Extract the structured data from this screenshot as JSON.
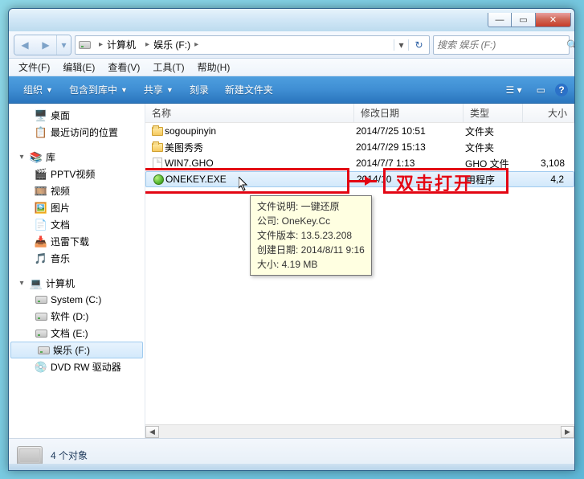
{
  "titlebar": {
    "min": "—",
    "max": "▭",
    "close": "✕"
  },
  "nav": {
    "back": "◀",
    "fwd": "▶",
    "dd": "▾",
    "path": {
      "seg1": "计算机",
      "seg2": "娱乐 (F:)"
    },
    "refresh": "↻"
  },
  "search": {
    "placeholder": "搜索 娱乐 (F:)",
    "icon": "🔍"
  },
  "menu": {
    "file": "文件(F)",
    "edit": "编辑(E)",
    "view": "查看(V)",
    "tools": "工具(T)",
    "help": "帮助(H)"
  },
  "toolbar": {
    "organize": "组织",
    "include": "包含到库中",
    "share": "共享",
    "burn": "刻录",
    "newfolder": "新建文件夹"
  },
  "columns": {
    "name": "名称",
    "date": "修改日期",
    "type": "类型",
    "size": "大小"
  },
  "navpane": {
    "desktop": "桌面",
    "recent": "最近访问的位置",
    "libraries": "库",
    "pptv": "PPTV视频",
    "videos": "视频",
    "pictures": "图片",
    "documents": "文档",
    "xunlei": "迅雷下载",
    "music": "音乐",
    "computer": "计算机",
    "systemc": "System (C:)",
    "softd": "软件 (D:)",
    "doce": "文档 (E:)",
    "funf": "娱乐 (F:)",
    "dvd": "DVD RW 驱动器"
  },
  "files": [
    {
      "name": "sogoupinyin",
      "date": "2014/7/25 10:51",
      "type": "文件夹",
      "size": "",
      "icon": "folder"
    },
    {
      "name": "美图秀秀",
      "date": "2014/7/29 15:13",
      "type": "文件夹",
      "size": "",
      "icon": "folder"
    },
    {
      "name": "WIN7.GHO",
      "date": "2014/7/7 1:13",
      "type": "GHO 文件",
      "size": "3,108",
      "icon": "gho"
    },
    {
      "name": "ONEKEY.EXE",
      "date": "2014/10",
      "type": "用程序",
      "size": "4,2",
      "icon": "exe",
      "selected": true
    }
  ],
  "tooltip": {
    "l1": "文件说明: 一键还原",
    "l2": "公司: OneKey.Cc",
    "l3": "文件版本: 13.5.23.208",
    "l4": "创建日期: 2014/8/11 9:16",
    "l5": "大小: 4.19 MB"
  },
  "status": {
    "text": "4 个对象"
  },
  "annotation": {
    "label": "双击打开"
  }
}
